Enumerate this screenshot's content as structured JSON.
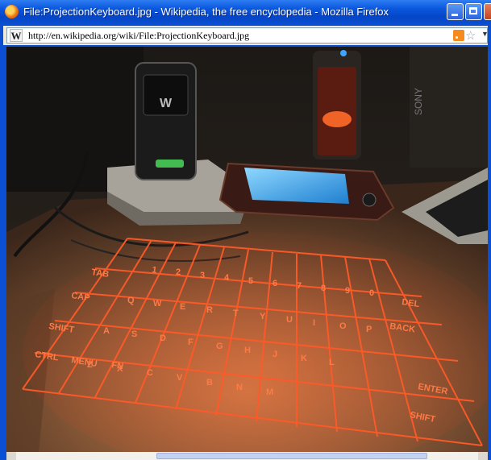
{
  "window": {
    "title": "File:ProjectionKeyboard.jpg - Wikipedia, the free encyclopedia - Mozilla Firefox"
  },
  "address": {
    "site_icon_letter": "W",
    "url": "http://en.wikipedia.org/wiki/File:ProjectionKeyboard.jpg"
  },
  "icons": [
    "firefox-icon",
    "wikipedia-site-icon",
    "rss-feed-icon",
    "bookmark-star-icon",
    "dropdown-arrow-icon",
    "minimize-icon",
    "maximize-icon",
    "close-icon"
  ],
  "image": {
    "scene_text": {
      "left_phone_brand": "W",
      "right_device_brand": "SONY"
    },
    "keyboard_rows": [
      [
        "1",
        "2",
        "3",
        "4",
        "5",
        "6",
        "7",
        "8",
        "9",
        "0",
        "-",
        "=",
        "DEL"
      ],
      [
        "TAB",
        "Q",
        "W",
        "E",
        "R",
        "T",
        "Y",
        "U",
        "I",
        "O",
        "P",
        "BACK"
      ],
      [
        "CAP",
        "A",
        "S",
        "D",
        "F",
        "G",
        "H",
        "J",
        "K",
        "L",
        ";",
        "'",
        "ENTER"
      ],
      [
        "SHIFT",
        "Z",
        "X",
        "C",
        "V",
        "B",
        "N",
        "M",
        ",",
        ".",
        "/",
        "SHIFT"
      ],
      [
        "CTRL",
        "MENU",
        "FN"
      ]
    ]
  },
  "colors": {
    "titlebar": "#0a58de",
    "laser": "#ff5a28",
    "desk": "#8a5a38"
  }
}
